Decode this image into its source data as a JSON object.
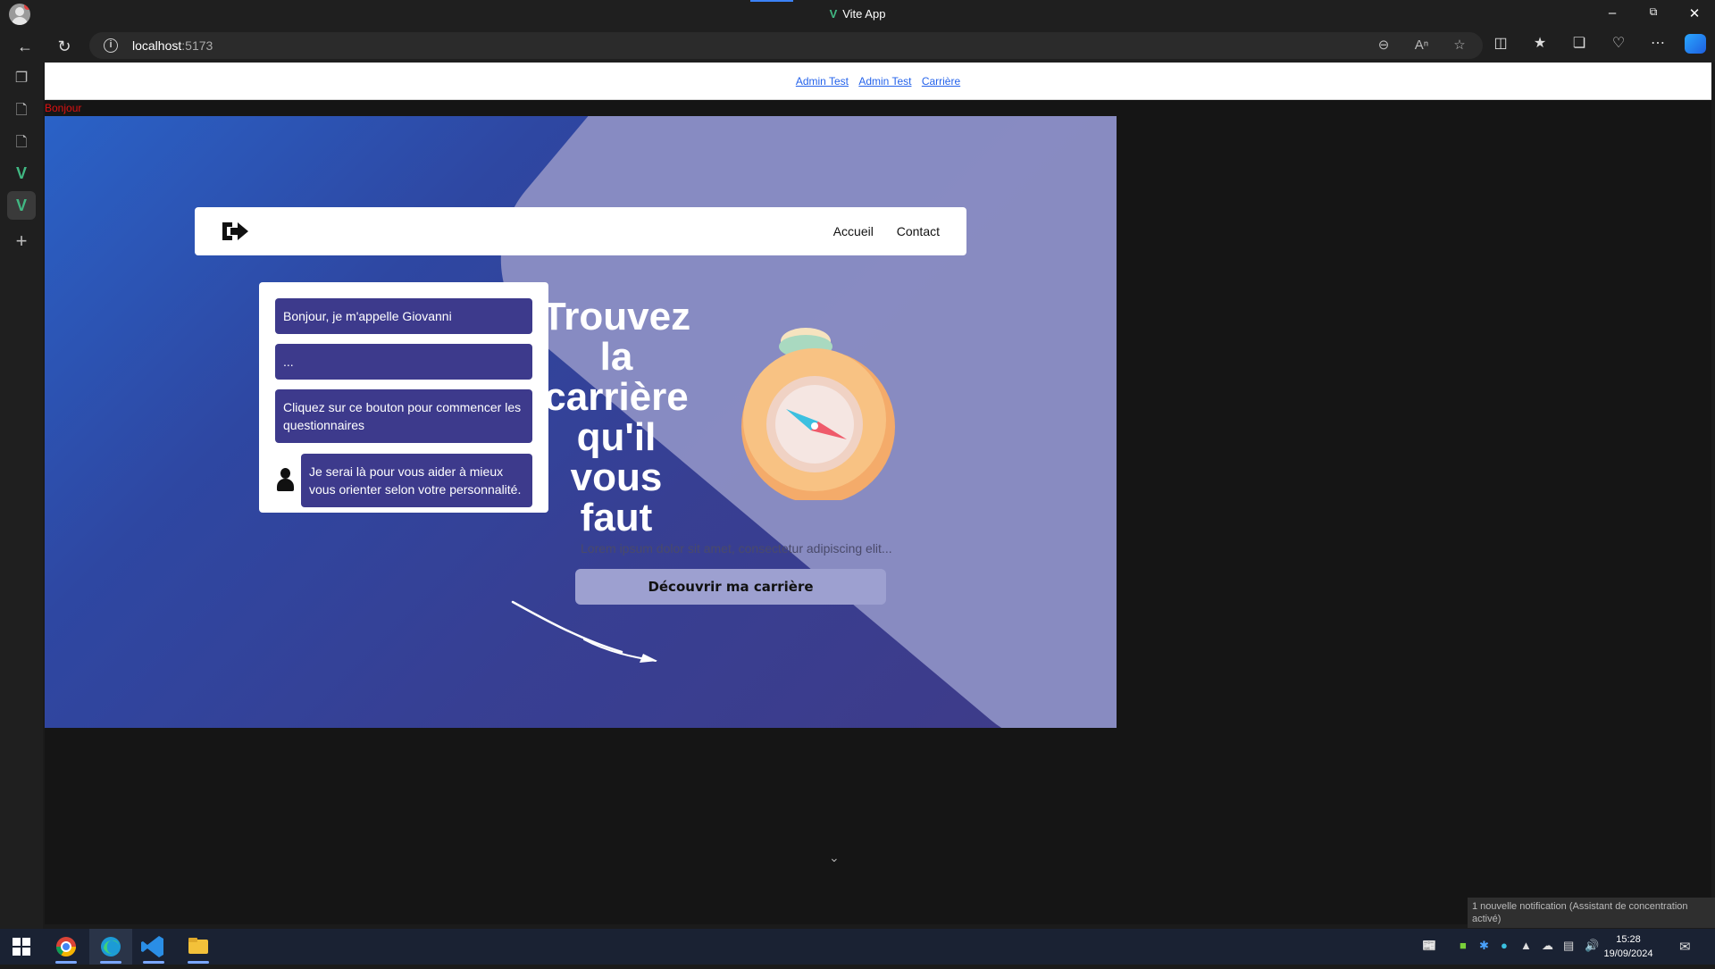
{
  "browser": {
    "window_title": "Vite App",
    "url_host": "localhost",
    "url_port": ":5173"
  },
  "page": {
    "top_links": [
      "Admin Test",
      "Admin Test",
      "Carrière"
    ],
    "greeting": "Bonjour",
    "nav_links": {
      "home": "Accueil",
      "contact": "Contact"
    },
    "chat": {
      "messages": [
        "Bonjour, je m'appelle Giovanni",
        "...",
        "Cliquez sur ce bouton pour commencer les questionnaires",
        "Je serai là pour vous aider à mieux vous orienter selon votre personnalité."
      ]
    },
    "headline": "Trouvez la carrière qu'il vous faut",
    "subtitle": "Lorem ipsum dolor sit amet, consectetur adipiscing elit...",
    "cta_label": "Découvrir ma carrière"
  },
  "notification": "1 nouvelle notification (Assistant de concentration activé)",
  "taskbar": {
    "time": "15:28",
    "date": "19/09/2024"
  },
  "colors": {
    "hero_gradient_start": "#2a62c7",
    "hero_gradient_end": "#3f3b88",
    "chat_bubble": "#3d3a8c",
    "cta_background": "#9da0d0",
    "greeting_red": "#d11111"
  }
}
